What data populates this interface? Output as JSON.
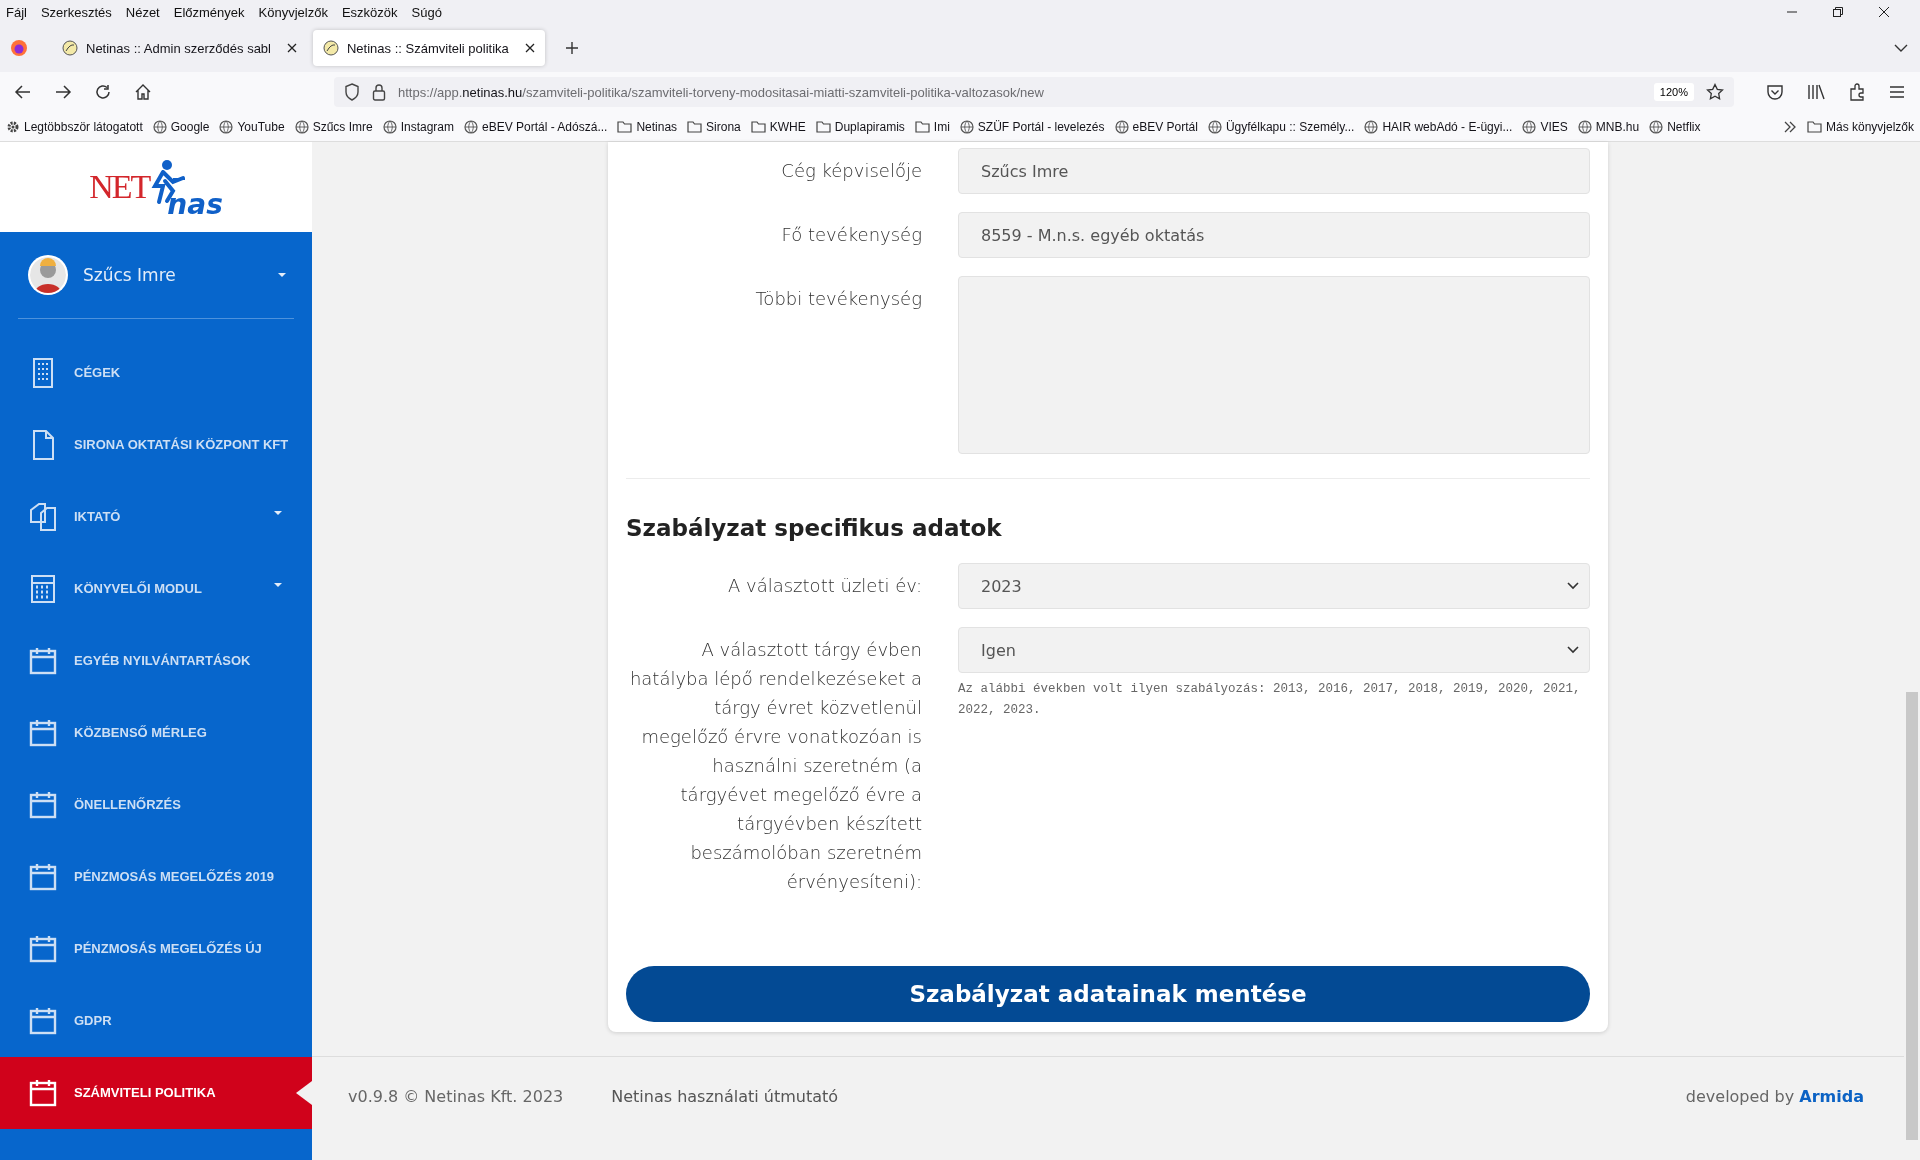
{
  "browser": {
    "menu": [
      "Fájl",
      "Szerkesztés",
      "Nézet",
      "Előzmények",
      "Könyvjelzők",
      "Eszközök",
      "Súgó"
    ],
    "tabs": [
      {
        "title": "Netinas :: Admin szerződés sabl",
        "selected": false
      },
      {
        "title": "Netinas :: Számviteli politika",
        "selected": true
      }
    ],
    "url": {
      "prefix": "https://app.",
      "domain": "netinas.hu",
      "path": "/szamviteli-politika/szamviteli-torveny-modositasai-miatti-szamviteli-politika-valtozasok/new"
    },
    "zoom": "120%",
    "bookmarks": [
      {
        "label": "Legtöbbször látogatott",
        "kind": "gear"
      },
      {
        "label": "Google",
        "kind": "site"
      },
      {
        "label": "YouTube",
        "kind": "site"
      },
      {
        "label": "Szűcs Imre",
        "kind": "site"
      },
      {
        "label": "Instagram",
        "kind": "site"
      },
      {
        "label": "eBEV Portál - Adószá...",
        "kind": "site"
      },
      {
        "label": "Netinas",
        "kind": "folder"
      },
      {
        "label": "Sirona",
        "kind": "folder"
      },
      {
        "label": "KWHE",
        "kind": "folder"
      },
      {
        "label": "Duplapiramis",
        "kind": "folder"
      },
      {
        "label": "Imi",
        "kind": "folder"
      },
      {
        "label": "SZÜF Portál - levelezés",
        "kind": "site"
      },
      {
        "label": "eBEV Portál",
        "kind": "site"
      },
      {
        "label": "Ügyfélkapu :: Személy...",
        "kind": "site"
      },
      {
        "label": "HAIR webAdó - E-ügyi...",
        "kind": "site"
      },
      {
        "label": "VIES",
        "kind": "site"
      },
      {
        "label": "MNB.hu",
        "kind": "site"
      },
      {
        "label": "Netflix",
        "kind": "site"
      }
    ],
    "other_bookmarks": "Más könyvjelzők"
  },
  "logo": {
    "part1": "NET",
    "part2": "nas"
  },
  "user": {
    "name": "Szűcs Imre"
  },
  "sidebar": {
    "items": [
      {
        "label": "CÉGEK",
        "kind": "building",
        "expandable": false,
        "selected": false
      },
      {
        "label": "SIRONA OKTATÁSI KÖZPONT KFT",
        "kind": "file",
        "expandable": false,
        "selected": false
      },
      {
        "label": "IKTATÓ",
        "kind": "copy",
        "expandable": true,
        "selected": false
      },
      {
        "label": "KÖNYVELŐI MODUL",
        "kind": "calculator",
        "expandable": true,
        "selected": false
      },
      {
        "label": "EGYÉB NYILVÁNTARTÁSOK",
        "kind": "calendar",
        "expandable": false,
        "selected": false
      },
      {
        "label": "KÖZBENSŐ MÉRLEG",
        "kind": "calendar",
        "expandable": false,
        "selected": false
      },
      {
        "label": "ÖNELLENŐRZÉS",
        "kind": "calendar",
        "expandable": false,
        "selected": false
      },
      {
        "label": "PÉNZMOSÁS MEGELŐZÉS 2019",
        "kind": "calendar",
        "expandable": false,
        "selected": false
      },
      {
        "label": "PÉNZMOSÁS MEGELŐZÉS ÚJ",
        "kind": "calendar",
        "expandable": false,
        "selected": false
      },
      {
        "label": "GDPR",
        "kind": "calendar",
        "expandable": false,
        "selected": false
      },
      {
        "label": "SZÁMVITELI POLITIKA",
        "kind": "calendar",
        "expandable": false,
        "selected": true
      }
    ]
  },
  "form": {
    "rows": [
      {
        "label": "Cég képviselője",
        "kind": "input",
        "value": "Szűcs Imre"
      },
      {
        "label": "Fő tevékenység",
        "kind": "input",
        "value": "8559 - M.n.s. egyéb oktatás"
      },
      {
        "label": "Többi tevékenység",
        "kind": "textarea"
      }
    ],
    "section_title": "Szabályzat specifikus adatok",
    "section_rows": [
      {
        "label": "A választott üzleti év:",
        "kind": "select",
        "value": "2023"
      },
      {
        "label": "A választott tárgy évben hatályba lépő rendelkezéseket a tárgy évret közvetlenül megelőző érvre vonatkozóan is használni szeretném (a tárgyévet megelőző évre a tárgyévben készített beszámolóban szeretném érvényesíteni):",
        "kind": "select",
        "value": "Igen",
        "hint": "Az alábbi években volt ilyen szabályozás: 2013, 2016, 2017, 2018, 2019, 2020, 2021, 2022, 2023."
      }
    ],
    "save_button": "Szabályzat adatainak mentése"
  },
  "footer": {
    "version": "v0.9.8 © Netinas Kft. 2023",
    "guide_link": "Netinas használati útmutató",
    "developed": "developed by",
    "developer": "Armida"
  }
}
